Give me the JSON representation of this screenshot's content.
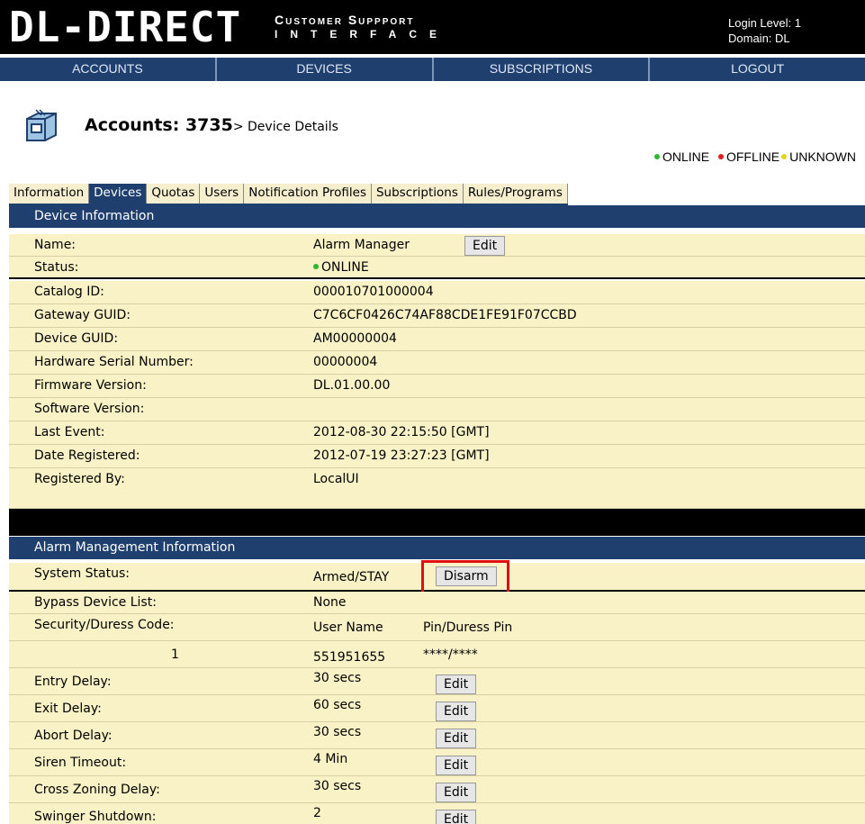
{
  "header": {
    "logo": "DL-DIRECT",
    "subtitle_line1": "Customer Suppport",
    "subtitle_line2": "INTERFACE",
    "login_level": "Login Level: 1",
    "domain": "Domain: DL"
  },
  "nav": [
    "ACCOUNTS",
    "DEVICES",
    "SUBSCRIPTIONS",
    "LOGOUT"
  ],
  "page": {
    "title": "Accounts: 3735",
    "crumb": "> Device Details"
  },
  "legend": {
    "online": "ONLINE",
    "offline": "OFFLINE",
    "unknown": "UNKNOWN",
    "online_color": "#2db52d",
    "offline_color": "#e02020",
    "unknown_color": "#e8d020"
  },
  "tabs": [
    "Information",
    "Devices",
    "Quotas",
    "Users",
    "Notification Profiles",
    "Subscriptions",
    "Rules/Programs"
  ],
  "active_tab": "Devices",
  "device_info": {
    "heading": "Device Information",
    "name_label": "Name:",
    "name_value": "Alarm Manager",
    "edit_label": "Edit",
    "status_label": "Status:",
    "status_value": "ONLINE",
    "rows": [
      {
        "label": "Catalog ID:",
        "value": "000010701000004"
      },
      {
        "label": "Gateway GUID:",
        "value": "C7C6CF0426C74AF88CDE1FE91F07CCBD"
      },
      {
        "label": "Device GUID:",
        "value": "AM00000004"
      },
      {
        "label": "Hardware Serial Number:",
        "value": "00000004"
      },
      {
        "label": "Firmware Version:",
        "value": "DL.01.00.00"
      },
      {
        "label": "Software Version:",
        "value": ""
      },
      {
        "label": "Last Event:",
        "value": "2012-08-30 22:15:50 [GMT]"
      },
      {
        "label": "Date Registered:",
        "value": "2012-07-19 23:27:23 [GMT]"
      },
      {
        "label": "Registered By:",
        "value": "LocalUI"
      }
    ]
  },
  "alarm": {
    "heading": "Alarm Management Information",
    "system_status_label": "System Status:",
    "system_status_value": "Armed/STAY",
    "disarm_label": "Disarm",
    "bypass_label": "Bypass Device List:",
    "bypass_value": "None",
    "code_label": "Security/Duress Code:",
    "col_user": "User Name",
    "col_pin": "Pin/Duress Pin",
    "code_index": "1",
    "code_user": "551951655",
    "code_pin": "****/****",
    "edit_label": "Edit",
    "delays": [
      {
        "label": "Entry Delay:",
        "value": "30 secs"
      },
      {
        "label": "Exit Delay:",
        "value": "60 secs"
      },
      {
        "label": "Abort Delay:",
        "value": "30 secs"
      },
      {
        "label": "Siren Timeout:",
        "value": "4 Min"
      },
      {
        "label": "Cross Zoning Delay:",
        "value": "30 secs"
      },
      {
        "label": "Swinger Shutdown:",
        "value": "2"
      }
    ]
  }
}
